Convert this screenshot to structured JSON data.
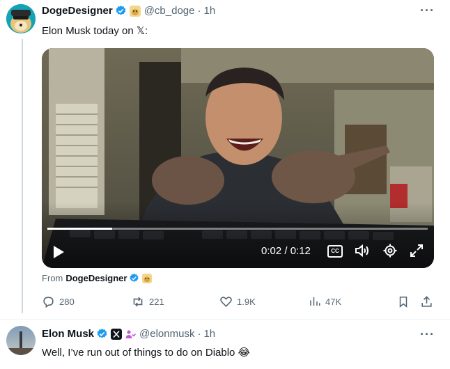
{
  "tweet1": {
    "display_name": "DogeDesigner",
    "handle": "@cb_doge",
    "time": "1h",
    "text": "Elon Musk today on 𝕏:",
    "media": {
      "time_display": "0:02 / 0:12",
      "progress": 0.17,
      "cc_label": "CC"
    },
    "from_prefix": "From",
    "from_name": "DogeDesigner",
    "stats": {
      "replies": "280",
      "reposts": "221",
      "likes": "1.9K",
      "views": "47K"
    }
  },
  "tweet2": {
    "display_name": "Elon Musk",
    "handle": "@elonmusk",
    "time": "1h",
    "text": "Well, I’ve run out of things to do on Diablo 😂"
  },
  "colors": {
    "verified": "#1d9bf0",
    "muted": "#536471",
    "line": "#cfd9de"
  },
  "icons": [
    "more-icon",
    "verified-icon",
    "doge-badge-icon",
    "play-icon",
    "cc-icon",
    "volume-icon",
    "settings-icon",
    "fullscreen-icon",
    "reply-icon",
    "repost-icon",
    "like-icon",
    "views-icon",
    "bookmark-icon",
    "share-icon",
    "x-logo-icon",
    "affiliate-icon"
  ]
}
